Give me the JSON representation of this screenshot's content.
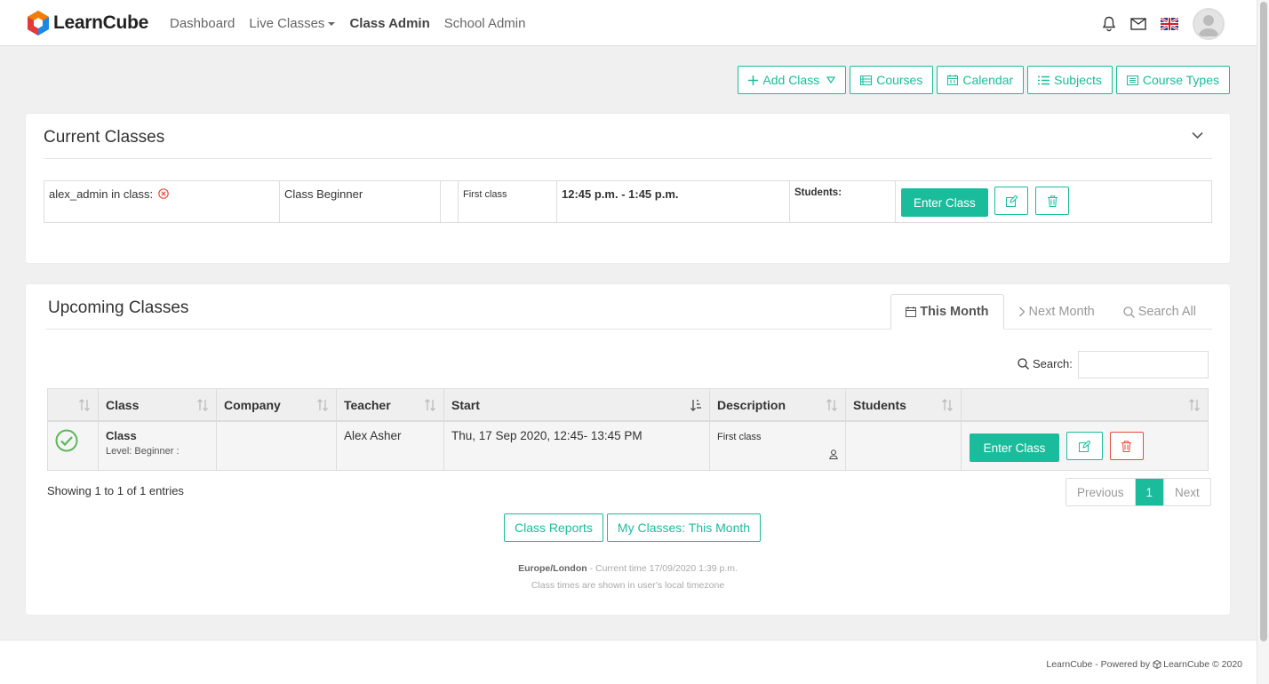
{
  "brand": {
    "name": "LearnCube"
  },
  "nav": {
    "dashboard": "Dashboard",
    "live_classes": "Live Classes",
    "class_admin": "Class Admin",
    "school_admin": "School Admin"
  },
  "toolbar": {
    "add_class": "Add Class",
    "courses": "Courses",
    "calendar": "Calendar",
    "subjects": "Subjects",
    "course_types": "Course Types"
  },
  "current": {
    "title": "Current Classes",
    "row": {
      "user": "alex_admin in class:",
      "class_name": "Class Beginner",
      "extra": "",
      "description": "First class",
      "time": "12:45 p.m. - 1:45 p.m.",
      "students_label": "Students:",
      "enter_label": "Enter Class"
    }
  },
  "upcoming": {
    "title": "Upcoming Classes",
    "tabs": {
      "this_month": "This Month",
      "next_month": "Next Month",
      "search_all": "Search All"
    },
    "search_label": "Search:",
    "search_value": "",
    "columns": [
      "",
      "Class",
      "Company",
      "Teacher",
      "Start",
      "Description",
      "Students",
      ""
    ],
    "row": {
      "class": "Class",
      "level": "Level: Beginner :",
      "company": "",
      "teacher": "Alex Asher",
      "start": "Thu, 17 Sep 2020, 12:45- 13:45 PM",
      "description": "First class",
      "students": "",
      "enter_label": "Enter Class"
    },
    "showing": "Showing 1 to 1 of 1 entries",
    "pager": {
      "prev": "Previous",
      "page": "1",
      "next": "Next"
    },
    "reports_btn": "Class Reports",
    "my_classes_btn": "My Classes: This Month",
    "timezone": "Europe/London",
    "current_time": " - Current time 17/09/2020 1:39 p.m.",
    "tz_note": "Class times are shown in user's local timezone"
  },
  "footer": {
    "prefix": "LearnCube - Powered by",
    "brand": "LearnCube © 2020"
  },
  "colors": {
    "accent": "#1abc9c",
    "danger": "#e74c3c",
    "success": "#5cb85c"
  }
}
